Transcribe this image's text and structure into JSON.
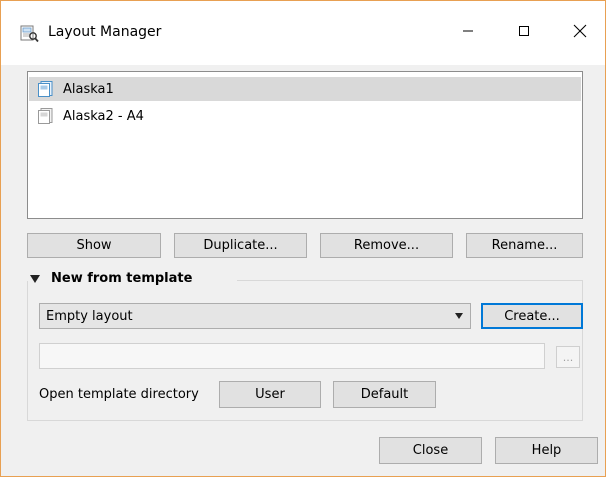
{
  "window": {
    "title": "Layout Manager",
    "icon": "layout-manager-icon",
    "controls": [
      "minimize-icon",
      "maximize-icon",
      "close-icon"
    ]
  },
  "layouts": [
    {
      "name": "Alaska1",
      "selected": true,
      "icon": "layout-page-icon"
    },
    {
      "name": "Alaska2 - A4",
      "selected": false,
      "icon": "layout-page-icon"
    }
  ],
  "actions": {
    "show": "Show",
    "duplicate": "Duplicate...",
    "remove": "Remove...",
    "rename": "Rename..."
  },
  "template_group": {
    "title": "New from template",
    "expanded": true,
    "selected_template": "Empty layout",
    "create": "Create...",
    "template_path": "",
    "browse": "...",
    "open_directory_label": "Open template directory",
    "user": "User",
    "default": "Default"
  },
  "footer": {
    "close": "Close",
    "help": "Help"
  },
  "colors": {
    "selection": "#d9d9d9",
    "focus_border": "#0078d7",
    "window_border": "#e8a052"
  }
}
